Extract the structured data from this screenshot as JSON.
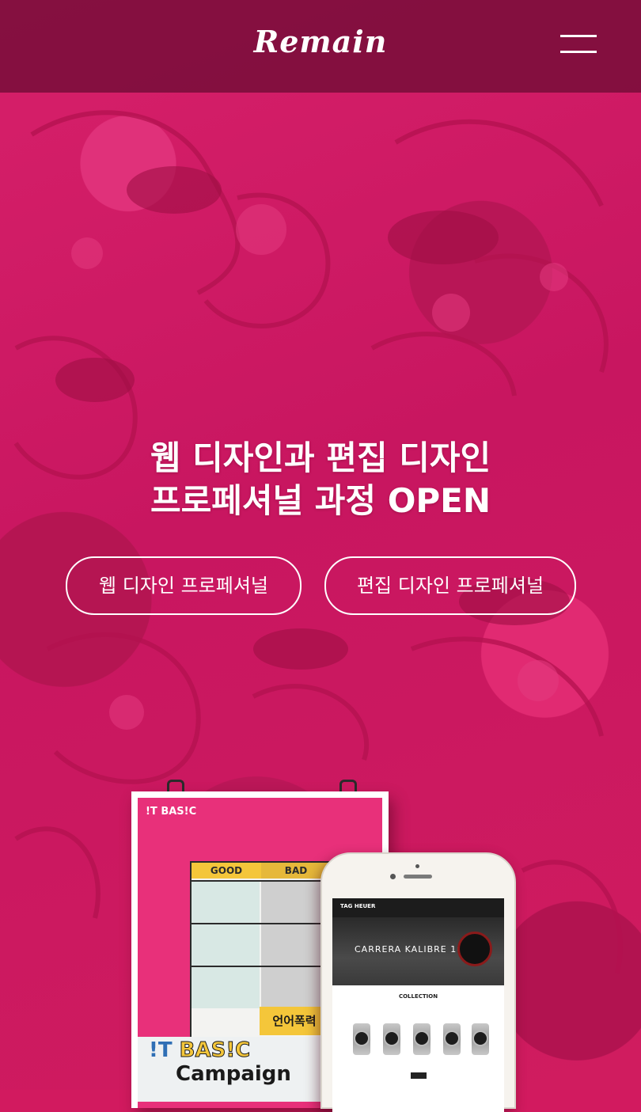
{
  "header": {
    "logo": "Remain"
  },
  "hero": {
    "headline_line1": "웹 디자인과 편집 디자인",
    "headline_line2": "프로페셔널 과정 OPEN",
    "buttons": [
      {
        "label": "웹 디자인 프로페셔널"
      },
      {
        "label": "편집 디자인 프로페셔널"
      }
    ]
  },
  "mockup": {
    "poster": {
      "brand": "!T BAS!C",
      "col_good": "GOOD",
      "col_bad": "BAD",
      "sign": "언어폭력",
      "title_a": "!T",
      "title_b": "BAS!C",
      "title_c": "Campaign"
    },
    "phone": {
      "nav_brand": "TAG HEUER",
      "hero_title": "CARRERA KALIBRE 16",
      "collection": "COLLECTION"
    }
  },
  "colors": {
    "accent": "#d21a5f",
    "header": "#6e0c34",
    "text": "#ffffff"
  },
  "icons": {
    "menu": "hamburger-menu-icon"
  }
}
